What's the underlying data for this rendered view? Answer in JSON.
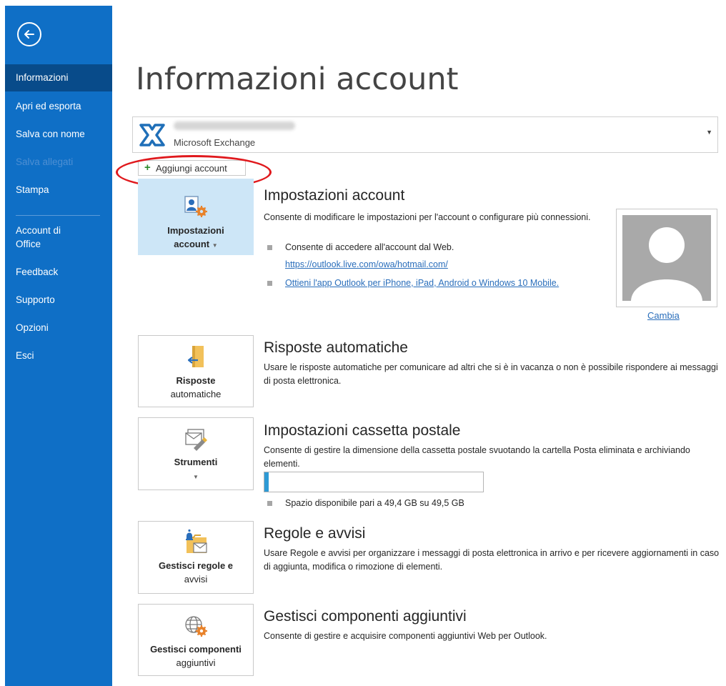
{
  "sidebar": {
    "back_label": "",
    "items": [
      {
        "label": "Informazioni",
        "state": "active"
      },
      {
        "label": "Apri ed esporta",
        "state": "normal"
      },
      {
        "label": "Salva con nome",
        "state": "normal"
      },
      {
        "label": "Salva allegati",
        "state": "disabled"
      },
      {
        "label": "Stampa",
        "state": "normal"
      },
      {
        "label": "Account di Office",
        "state": "normal"
      },
      {
        "label": "Feedback",
        "state": "normal"
      },
      {
        "label": "Supporto",
        "state": "normal"
      },
      {
        "label": "Opzioni",
        "state": "normal"
      },
      {
        "label": "Esci",
        "state": "normal"
      }
    ]
  },
  "main": {
    "title": "Informazioni account",
    "account_selector": {
      "account_type": "Microsoft Exchange",
      "icon": "exchange-icon"
    },
    "add_account_label": "Aggiungi account",
    "sections": {
      "account_settings": {
        "tile_line1": "Impostazioni",
        "tile_line2": "account",
        "title": "Impostazioni account",
        "description": "Consente di modificare le impostazioni per l'account o configurare più connessioni.",
        "bullet1": "Consente di accedere all'account dal Web.",
        "link1": "https://outlook.live.com/owa/hotmail.com/",
        "link2": "Ottieni l'app Outlook per iPhone, iPad, Android o Windows 10 Mobile."
      },
      "auto_replies": {
        "tile_line1": "Risposte",
        "tile_line2": "automatiche",
        "title": "Risposte automatiche",
        "description": "Usare le risposte automatiche per comunicare ad altri che si è in vacanza o non è possibile rispondere ai messaggi di posta elettronica."
      },
      "mailbox": {
        "tile_line1": "Strumenti",
        "title": "Impostazioni cassetta postale",
        "description": "Consente di gestire la dimensione della cassetta postale svuotando la cartella Posta eliminata e archiviando elementi.",
        "storage_used_fraction": 0.02,
        "storage_text": "Spazio disponibile pari a 49,4 GB su 49,5 GB"
      },
      "rules": {
        "tile_line1": "Gestisci regole e",
        "tile_line2": "avvisi",
        "title": "Regole e avvisi",
        "description": "Usare Regole e avvisi per organizzare i messaggi di posta elettronica in arrivo e per ricevere aggiornamenti in caso di aggiunta, modifica o rimozione di elementi."
      },
      "addins": {
        "tile_line1": "Gestisci componenti",
        "tile_line2": "aggiuntivi",
        "title": "Gestisci componenti aggiuntivi",
        "description": "Consente di gestire e acquisire componenti aggiuntivi Web per Outlook."
      }
    },
    "profile": {
      "change_label": "Cambia"
    }
  },
  "colors": {
    "sidebar": "#0f6fc6",
    "sidebar_active": "#084b8a",
    "selected_tile": "#cde6f7",
    "link": "#2a6ebb",
    "highlight_ellipse": "#e0191d",
    "storage_fill": "#2e9ad5"
  }
}
